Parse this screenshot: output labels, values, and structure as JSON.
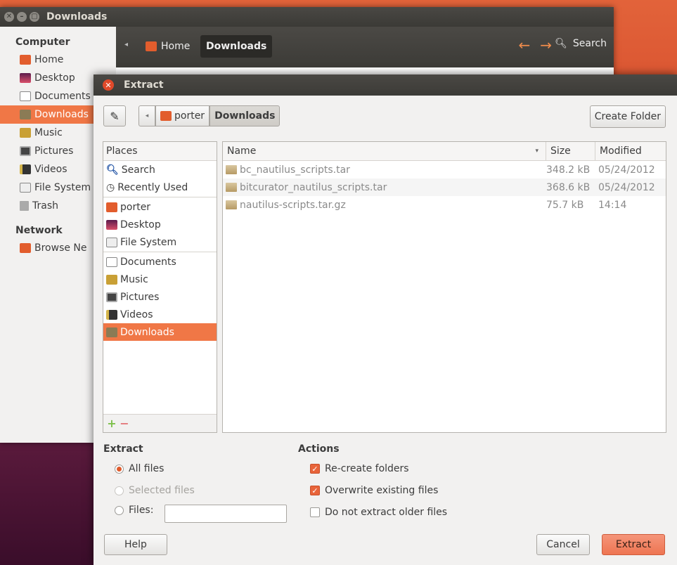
{
  "bg_window": {
    "title": "Downloads",
    "toolbar": {
      "home_label": "Home",
      "current_label": "Downloads",
      "search_label": "Search"
    },
    "sidebar": {
      "computer_heading": "Computer",
      "items": [
        {
          "label": "Home",
          "icon": "home-icon"
        },
        {
          "label": "Desktop",
          "icon": "desktop-icon"
        },
        {
          "label": "Documents",
          "icon": "documents-icon"
        },
        {
          "label": "Downloads",
          "icon": "downloads-icon",
          "active": true
        },
        {
          "label": "Music",
          "icon": "music-icon"
        },
        {
          "label": "Pictures",
          "icon": "pictures-icon"
        },
        {
          "label": "Videos",
          "icon": "videos-icon"
        },
        {
          "label": "File System",
          "icon": "filesystem-icon"
        },
        {
          "label": "Trash",
          "icon": "trash-icon"
        }
      ],
      "network_heading": "Network",
      "network_items": [
        {
          "label": "Browse Ne",
          "icon": "network-icon"
        }
      ]
    }
  },
  "dialog": {
    "title": "Extract",
    "path": {
      "parent_label": "porter",
      "current_label": "Downloads"
    },
    "create_folder_label": "Create Folder",
    "places": {
      "header": "Places",
      "group1": [
        {
          "label": "Search",
          "icon": "search-icon"
        },
        {
          "label": "Recently Used",
          "icon": "clock-icon"
        }
      ],
      "group2": [
        {
          "label": "porter",
          "icon": "home-icon"
        },
        {
          "label": "Desktop",
          "icon": "desktop-icon"
        },
        {
          "label": "File System",
          "icon": "filesystem-icon"
        }
      ],
      "group3": [
        {
          "label": "Documents",
          "icon": "documents-icon"
        },
        {
          "label": "Music",
          "icon": "music-icon"
        },
        {
          "label": "Pictures",
          "icon": "pictures-icon"
        },
        {
          "label": "Videos",
          "icon": "videos-icon"
        },
        {
          "label": "Downloads",
          "icon": "downloads-icon",
          "selected": true
        }
      ]
    },
    "files": {
      "columns": {
        "name": "Name",
        "size": "Size",
        "modified": "Modified"
      },
      "rows": [
        {
          "name": "bc_nautilus_scripts.tar",
          "size": "348.2 kB",
          "modified": "05/24/2012"
        },
        {
          "name": "bitcurator_nautilus_scripts.tar",
          "size": "368.6 kB",
          "modified": "05/24/2012"
        },
        {
          "name": "nautilus-scripts.tar.gz",
          "size": "75.7 kB",
          "modified": "14:14"
        }
      ]
    },
    "extract_section": {
      "title": "Extract",
      "all_files": "All files",
      "selected_files": "Selected files",
      "files_label": "Files:",
      "files_value": "",
      "choice": "All files"
    },
    "actions_section": {
      "title": "Actions",
      "recreate_folders": {
        "label": "Re-create folders",
        "checked": true
      },
      "overwrite_existing": {
        "label": "Overwrite existing files",
        "checked": true
      },
      "do_not_extract_older": {
        "label": "Do not extract older files",
        "checked": false
      }
    },
    "buttons": {
      "help": "Help",
      "cancel": "Cancel",
      "extract": "Extract"
    }
  }
}
